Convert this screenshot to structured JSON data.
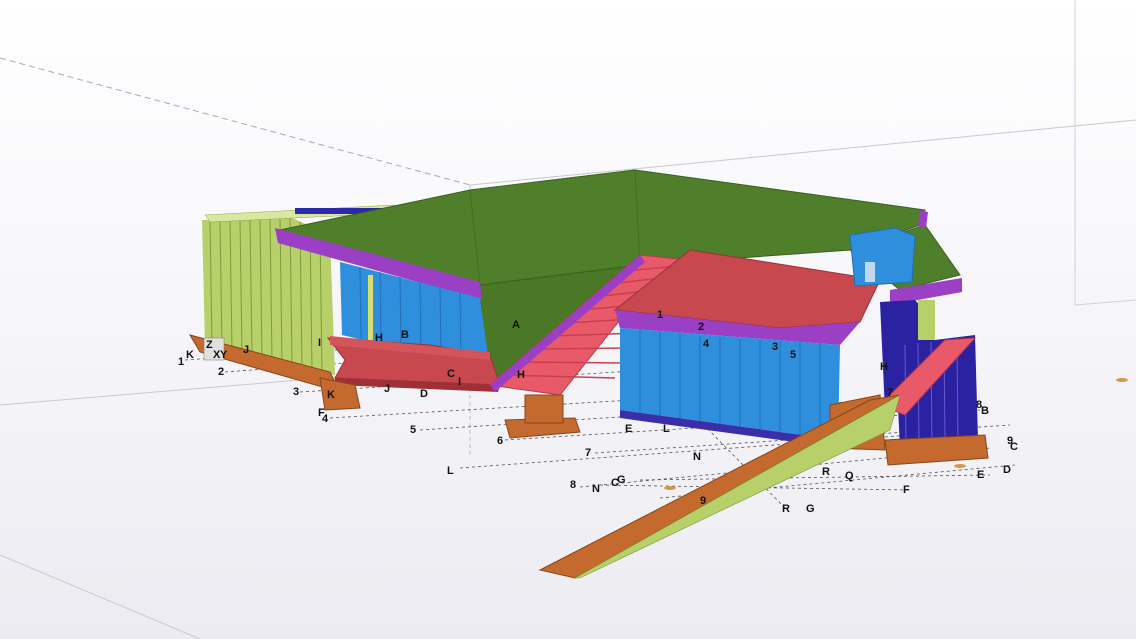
{
  "viewport": {
    "name": "3D model view",
    "colors": {
      "background_top": "#ffffff",
      "background_bottom": "#ebebf1",
      "roof": "#4f7f2a",
      "fascia": "#9b3fc4",
      "glass": "#2f8fdc",
      "glass_frame": "#3a2fa8",
      "stair": "#e85a6a",
      "slab": "#c8484f",
      "foundation": "#c46a2e",
      "cladding": "#b7d06a"
    }
  },
  "axes_indicator": {
    "z": "Z",
    "x": "X",
    "y": "Y"
  },
  "grid_labels": {
    "numbers": [
      "1",
      "2",
      "3",
      "4",
      "5",
      "6",
      "7",
      "8",
      "9"
    ],
    "letters": [
      "A",
      "B",
      "C",
      "D",
      "E",
      "F",
      "G",
      "H",
      "I",
      "J",
      "K",
      "L",
      "N",
      "Q",
      "R"
    ]
  }
}
